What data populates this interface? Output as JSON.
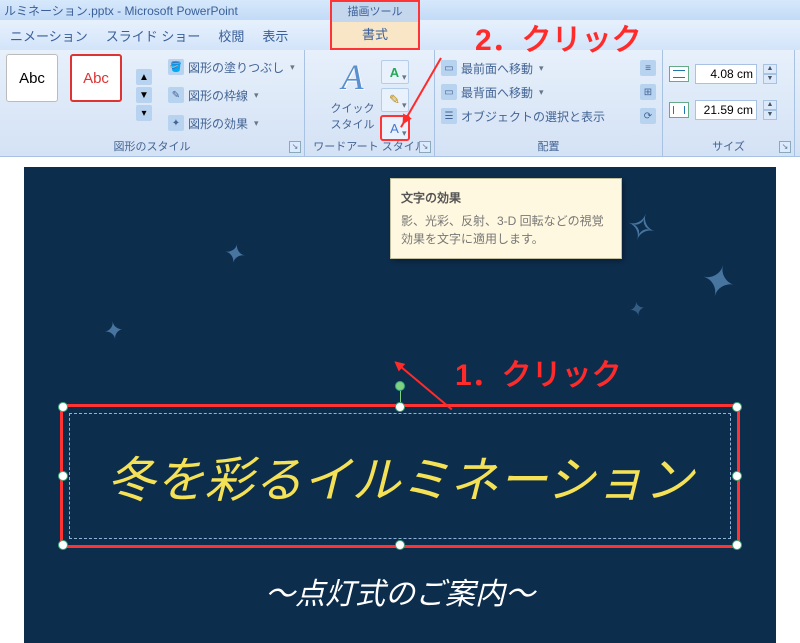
{
  "window": {
    "title": "ルミネーション.pptx - Microsoft PowerPoint"
  },
  "contextual_tab": {
    "group": "描画ツール",
    "tab": "書式"
  },
  "tabs": [
    "ニメーション",
    "スライド ショー",
    "校閲",
    "表示"
  ],
  "groups": {
    "style": {
      "label": "図形のスタイル",
      "presets": [
        "Abc",
        "Abc"
      ],
      "fill": "図形の塗りつぶし",
      "outline": "図形の枠線",
      "effects": "図形の効果"
    },
    "wordart": {
      "label": "ワードアート スタイル",
      "quick": "クイック\nスタイル"
    },
    "arrange": {
      "label": "配置",
      "front": "最前面へ移動",
      "back": "最背面へ移動",
      "select": "オブジェクトの選択と表示"
    },
    "size": {
      "label": "サイズ",
      "height": "4.08 cm",
      "width": "21.59 cm"
    }
  },
  "tooltip": {
    "title": "文字の効果",
    "body": "影、光彩、反射、3-D 回転などの視覚効果を文字に適用します。"
  },
  "callouts": {
    "one": "1．クリック",
    "two": "2．クリック"
  },
  "slide": {
    "title": "冬を彩るイルミネーション",
    "subtitle": "～点灯式のご案内～"
  }
}
